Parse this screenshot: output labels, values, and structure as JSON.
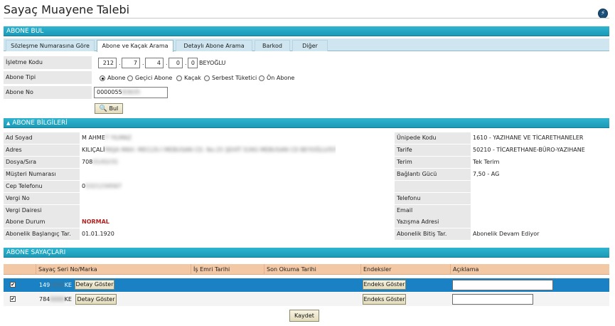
{
  "page": {
    "title": "Sayaç Muayene Talebi",
    "help_icon": "lightning-bolt-icon"
  },
  "abone_bul": {
    "header": "ABONE BUL",
    "tabs": [
      {
        "label": "Sözleşme Numarasına Göre",
        "active": false
      },
      {
        "label": "Abone ve Kaçak Arama",
        "active": true
      },
      {
        "label": "Detaylı Abone Arama",
        "active": false
      },
      {
        "label": "Barkod",
        "active": false
      },
      {
        "label": "Diğer",
        "active": false
      }
    ],
    "isletme_kodu": {
      "label": "İşletme Kodu",
      "parts": [
        "212",
        "7",
        "4",
        "0",
        "0"
      ],
      "district": "BEYOĞLU"
    },
    "abone_tipi": {
      "label": "Abone Tipi",
      "options": [
        {
          "label": "Abone",
          "selected": true
        },
        {
          "label": "Geçici Abone",
          "selected": false
        },
        {
          "label": "Kaçak",
          "selected": false
        },
        {
          "label": "Serbest Tüketici",
          "selected": false
        },
        {
          "label": "Ön Abone",
          "selected": false
        }
      ]
    },
    "abone_no": {
      "label": "Abone No",
      "value": "0000055",
      "value_masked": "83635"
    },
    "search_button": "Bul"
  },
  "abone_bilgileri": {
    "header": "ABONE BİLGİLERİ",
    "left": [
      {
        "label": "Ad Soyad",
        "value": "M AHME",
        "masked": "T YILMAZ",
        "style": "normal"
      },
      {
        "label": "Adres",
        "value": "KILIÇALİ",
        "masked": "PAŞA MAH. MECLİS-İ MEBUSAN CD. No:25 ŞEHİT İLYAS MEBUSAN CD BEYOĞLU/İSTANBUL",
        "style": "normal"
      },
      {
        "label": "Dosya/Sıra",
        "value": "708",
        "masked": "01/02/31",
        "style": "normal"
      },
      {
        "label": "Müşteri Numarası",
        "value": "",
        "masked": "",
        "style": "normal"
      },
      {
        "label": "Cep Telefonu",
        "value": "0",
        "masked": "5321234567",
        "style": "normal"
      },
      {
        "label": "Vergi No",
        "value": "",
        "masked": "",
        "style": "normal"
      },
      {
        "label": "Vergi Dairesi",
        "value": "",
        "masked": "",
        "style": "normal"
      },
      {
        "label": "Abone Durum",
        "value": "NORMAL",
        "masked": "",
        "style": "alert"
      },
      {
        "label": "Abonelik Başlangıç Tar.",
        "value": "01.01.1920",
        "masked": "",
        "style": "normal"
      }
    ],
    "right": [
      {
        "label": "Ünipede Kodu",
        "value": "1610 - YAZIHANE VE TİCARETHANELER"
      },
      {
        "label": "Tarife",
        "value": "50210 - TİCARETHANE-BÜRO-YAZIHANE"
      },
      {
        "label": "Terim",
        "value": "Tek Terim"
      },
      {
        "label": "Bağlantı Gücü",
        "value": "7,50 - AG"
      },
      {
        "label": "",
        "value": ""
      },
      {
        "label": "Telefonu",
        "value": ""
      },
      {
        "label": "Email",
        "value": ""
      },
      {
        "label": "Yazışma Adresi",
        "value": ""
      },
      {
        "label": "Abonelik Bitiş Tar.",
        "value": "Abonelik Devam Ediyor"
      }
    ]
  },
  "abone_sayaclari": {
    "header": "ABONE SAYAÇLARI",
    "columns": [
      "Sayaç Seri No/Marka",
      "İş Emri Tarihi",
      "Son Okuma Tarihi",
      "Endeksler",
      "Açıklama"
    ],
    "rows": [
      {
        "checked": true,
        "seri_prefix": "149",
        "seri_masked": "0000",
        "seri_suffix": "KE",
        "detail_button": "Detay Göster",
        "is_emri": "",
        "son_okuma": "",
        "endeks_button": "Endeks Göster",
        "aciklama": "",
        "selected": true
      },
      {
        "checked": true,
        "seri_prefix": "784",
        "seri_masked": "0000",
        "seri_suffix": "KE",
        "detail_button": "Detay Göster",
        "is_emri": "",
        "son_okuma": "",
        "endeks_button": "Endeks Göster",
        "aciklama": "",
        "selected": false
      }
    ],
    "save_button": "Kaydet"
  },
  "colors": {
    "section_header": "#1a9ab8",
    "tab_bar": "#cfe5ef",
    "table_header": "#f3c8a5",
    "selected_row": "#1a82c4",
    "alert_text": "#b22222"
  }
}
